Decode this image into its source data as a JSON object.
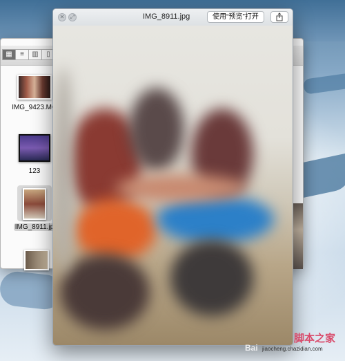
{
  "finder": {
    "files": [
      {
        "name": "IMG_9423.MO"
      },
      {
        "name": "123"
      },
      {
        "name": "IMG_8911.jp"
      }
    ]
  },
  "quicklook": {
    "title": "IMG_8911.jpg",
    "open_button": "使用“预览”打开",
    "share_icon": "share-icon"
  },
  "watermark": {
    "site": "脚本之家",
    "url": "jiaocheng.chazidian.com",
    "baidu": "Bai"
  }
}
